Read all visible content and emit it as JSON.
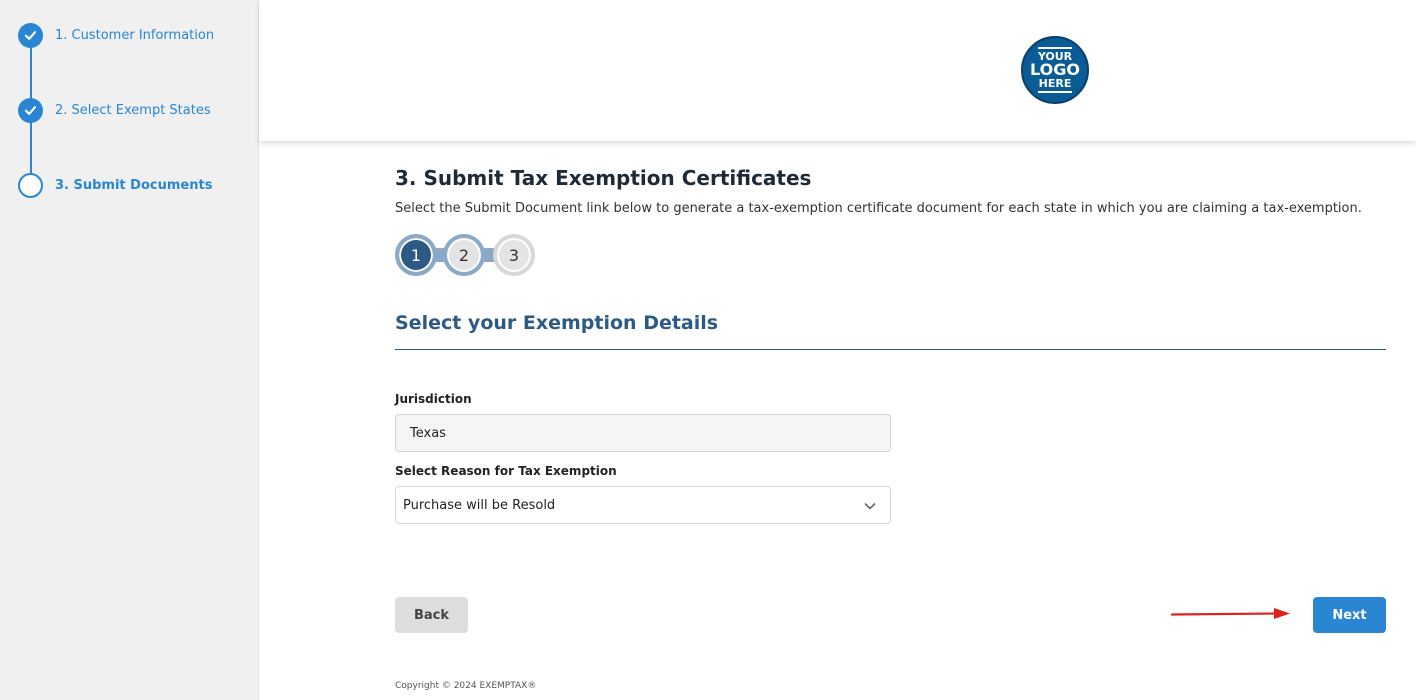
{
  "sidebar": {
    "steps": [
      {
        "label": "1. Customer Information",
        "status": "complete",
        "icon": "check-icon"
      },
      {
        "label": "2. Select Exempt States",
        "status": "complete",
        "icon": "check-icon"
      },
      {
        "label": "3. Submit Documents",
        "status": "current",
        "icon": "empty-circle-icon"
      }
    ]
  },
  "header": {
    "logo": {
      "line1": "YOUR",
      "line2": "LOGO",
      "line3": "HERE"
    }
  },
  "main": {
    "title": "3. Submit Tax Exemption Certificates",
    "description": "Select the Submit Document link below to generate a tax-exemption certificate document for each state in which you are claiming a tax-exemption.",
    "stepper": {
      "steps": [
        "1",
        "2",
        "3"
      ],
      "active": "1"
    },
    "section_title": "Select your Exemption Details",
    "jurisdiction": {
      "label": "Jurisdiction",
      "value": "Texas"
    },
    "reason": {
      "label": "Select Reason for Tax Exemption",
      "value": "Purchase will be Resold"
    },
    "back_label": "Back",
    "next_label": "Next"
  },
  "footer": {
    "copyright": "Copyright © 2024 EXEMPTAX®"
  },
  "colors": {
    "accent": "#2a86d3",
    "dark_blue": "#2c5a85",
    "annotation_arrow": "#e02020"
  }
}
